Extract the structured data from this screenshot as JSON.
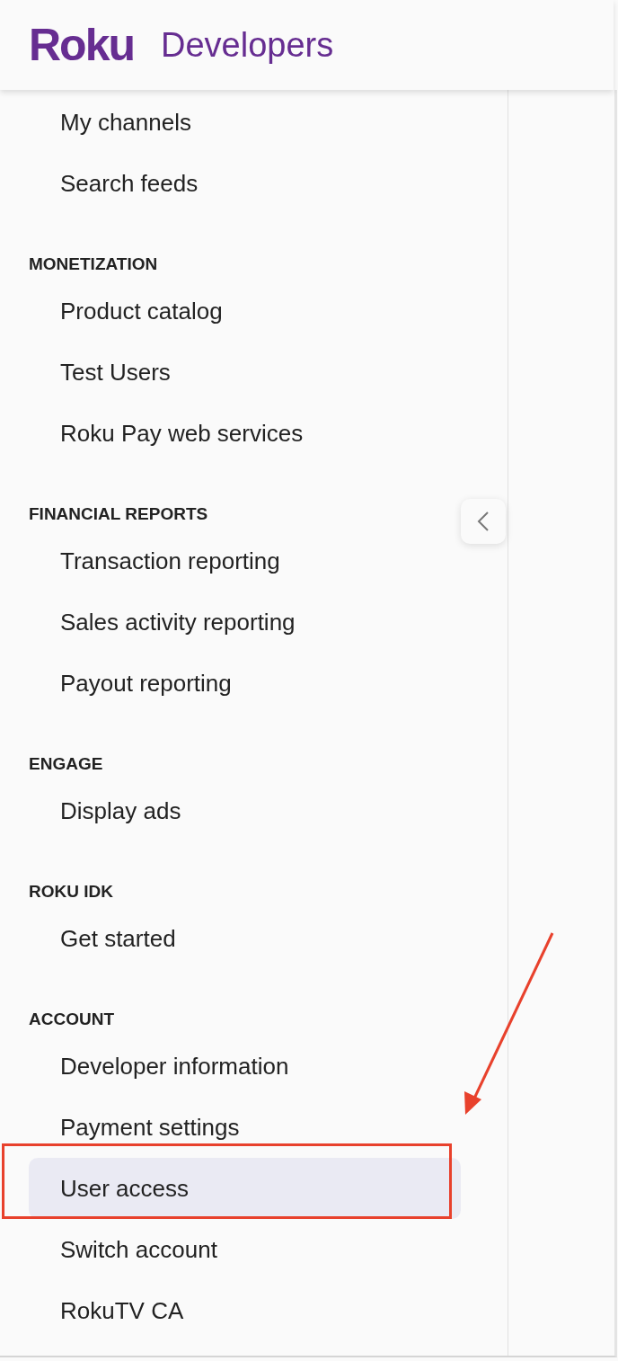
{
  "header": {
    "logo": "Roku",
    "title": "Developers"
  },
  "sidebar": {
    "sections": [
      {
        "items": [
          {
            "label": "My channels",
            "selected": false
          },
          {
            "label": "Search feeds",
            "selected": false
          }
        ]
      },
      {
        "heading": "MONETIZATION",
        "items": [
          {
            "label": "Product catalog",
            "selected": false
          },
          {
            "label": "Test Users",
            "selected": false
          },
          {
            "label": "Roku Pay web services",
            "selected": false
          }
        ]
      },
      {
        "heading": "FINANCIAL REPORTS",
        "items": [
          {
            "label": "Transaction reporting",
            "selected": false
          },
          {
            "label": "Sales activity reporting",
            "selected": false
          },
          {
            "label": "Payout reporting",
            "selected": false
          }
        ]
      },
      {
        "heading": "ENGAGE",
        "items": [
          {
            "label": "Display ads",
            "selected": false
          }
        ]
      },
      {
        "heading": "ROKU IDK",
        "items": [
          {
            "label": "Get started",
            "selected": false
          }
        ]
      },
      {
        "heading": "ACCOUNT",
        "items": [
          {
            "label": "Developer information",
            "selected": false
          },
          {
            "label": "Payment settings",
            "selected": false
          },
          {
            "label": "User access",
            "selected": true
          },
          {
            "label": "Switch account",
            "selected": false
          },
          {
            "label": "RokuTV CA",
            "selected": false
          }
        ]
      }
    ]
  }
}
